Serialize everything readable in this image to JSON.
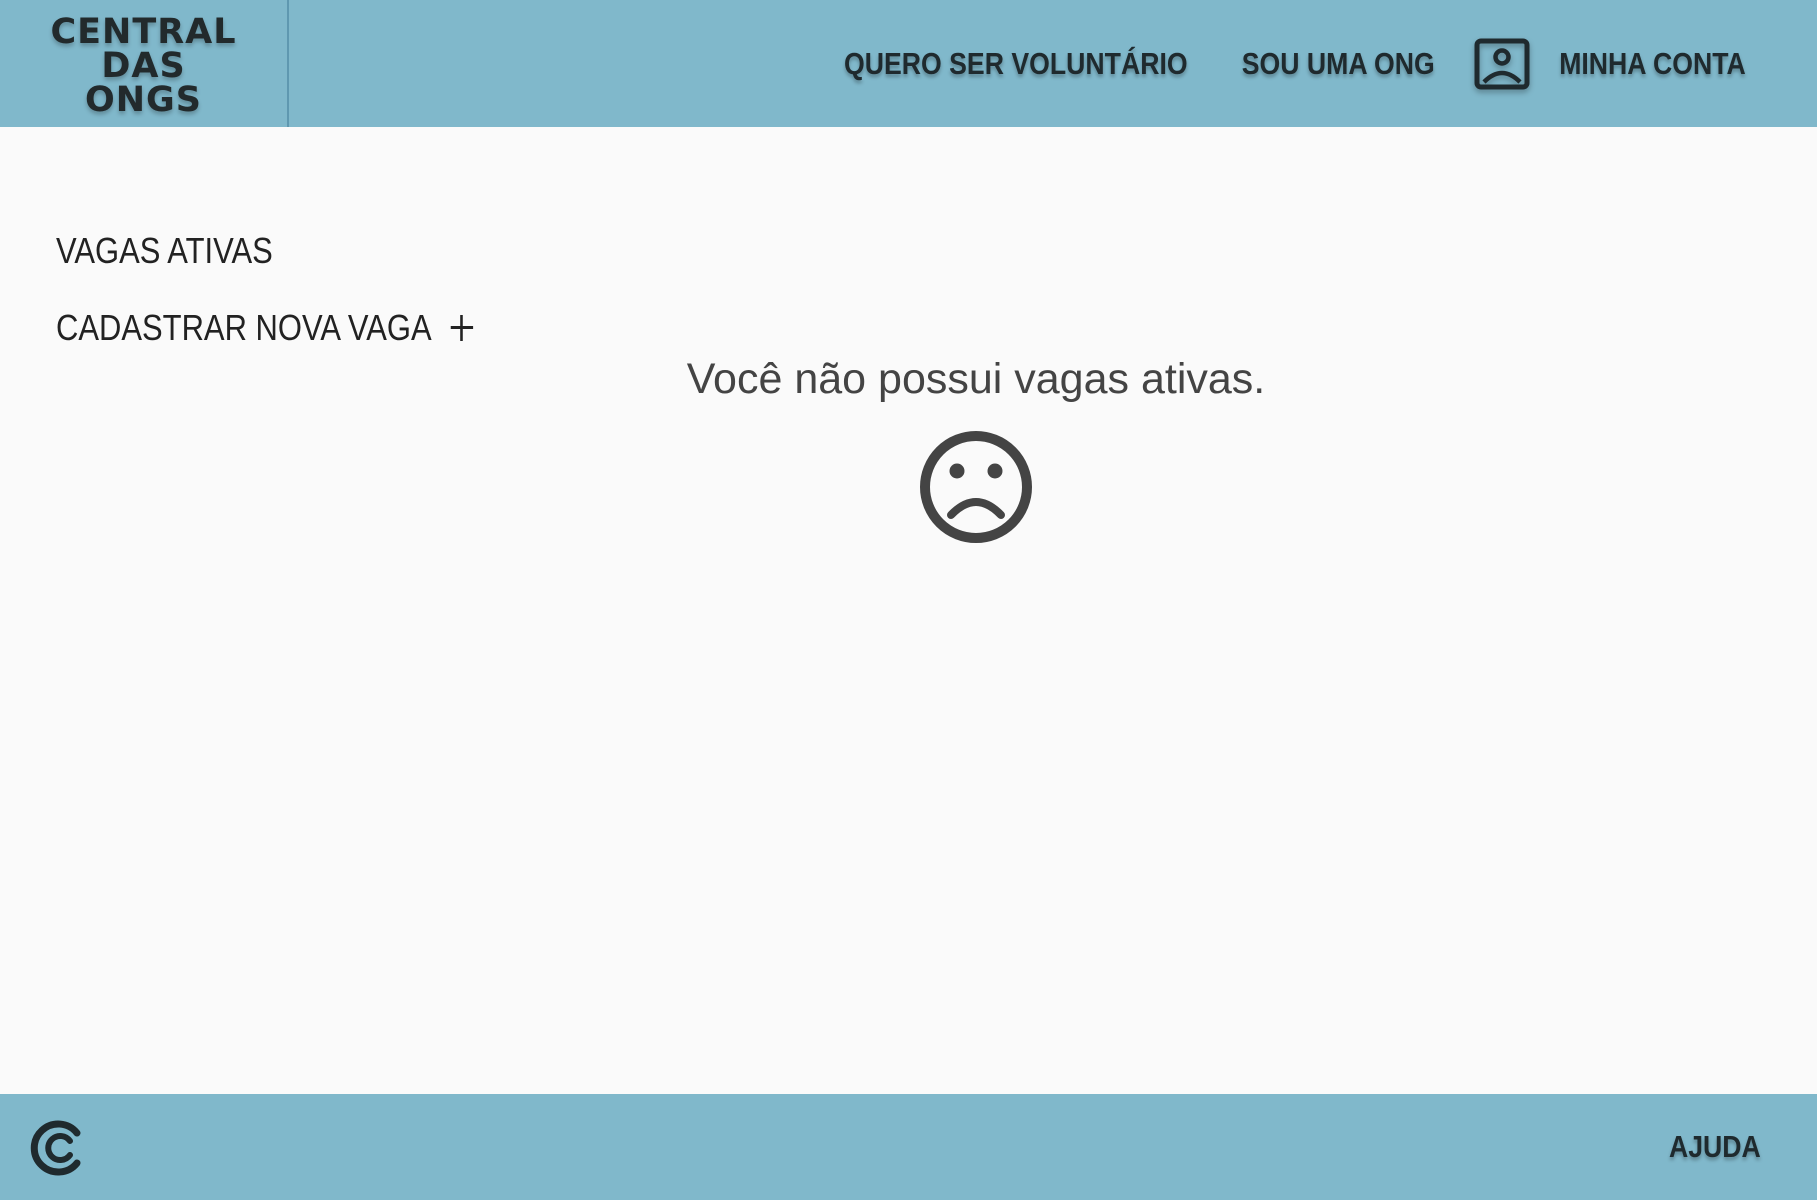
{
  "brand": {
    "logo_lines": [
      "CENTRAL",
      "DAS",
      "ONGS"
    ]
  },
  "nav": {
    "volunteer": "QUERO SER VOLUNTÁRIO",
    "ong": "SOU UMA ONG",
    "account": "MINHA CONTA",
    "account_icon": "user-account-icon"
  },
  "sidebar": {
    "items": [
      {
        "label": "VAGAS ATIVAS"
      },
      {
        "label": "CADASTRAR NOVA VAGA",
        "icon": "plus-icon"
      }
    ]
  },
  "main": {
    "empty_message": "Você não possui vagas ativas.",
    "empty_icon": "sad-face-icon"
  },
  "footer": {
    "logo_icon": "footer-logo-icon",
    "help": "AJUDA"
  },
  "colors": {
    "header_bg": "#80b8cb",
    "page_bg": "#fafafa",
    "text": "#222222",
    "muted_text": "#444444"
  }
}
